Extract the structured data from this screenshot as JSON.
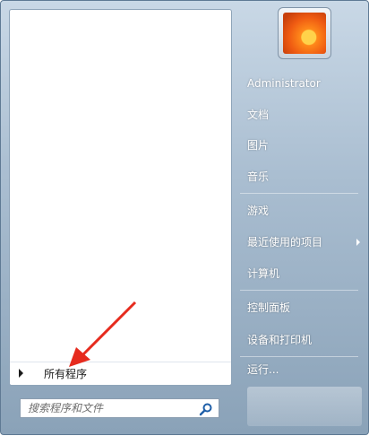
{
  "left_panel": {
    "all_programs_label": "所有程序",
    "search_placeholder": "搜索程序和文件"
  },
  "right_panel": {
    "user_name": "Administrator",
    "items": [
      {
        "label": "文档"
      },
      {
        "label": "图片"
      },
      {
        "label": "音乐"
      },
      {
        "label": "游戏"
      },
      {
        "label": "最近使用的项目"
      },
      {
        "label": "计算机"
      },
      {
        "label": "控制面板"
      },
      {
        "label": "设备和打印机"
      },
      {
        "label": "运行..."
      }
    ]
  },
  "colors": {
    "annotation_arrow": "#e62b1e",
    "right_panel_text": "#ffffff"
  },
  "icons": [
    "search-icon",
    "submenu-arrow-icon",
    "expand-arrow-icon",
    "user-picture"
  ]
}
